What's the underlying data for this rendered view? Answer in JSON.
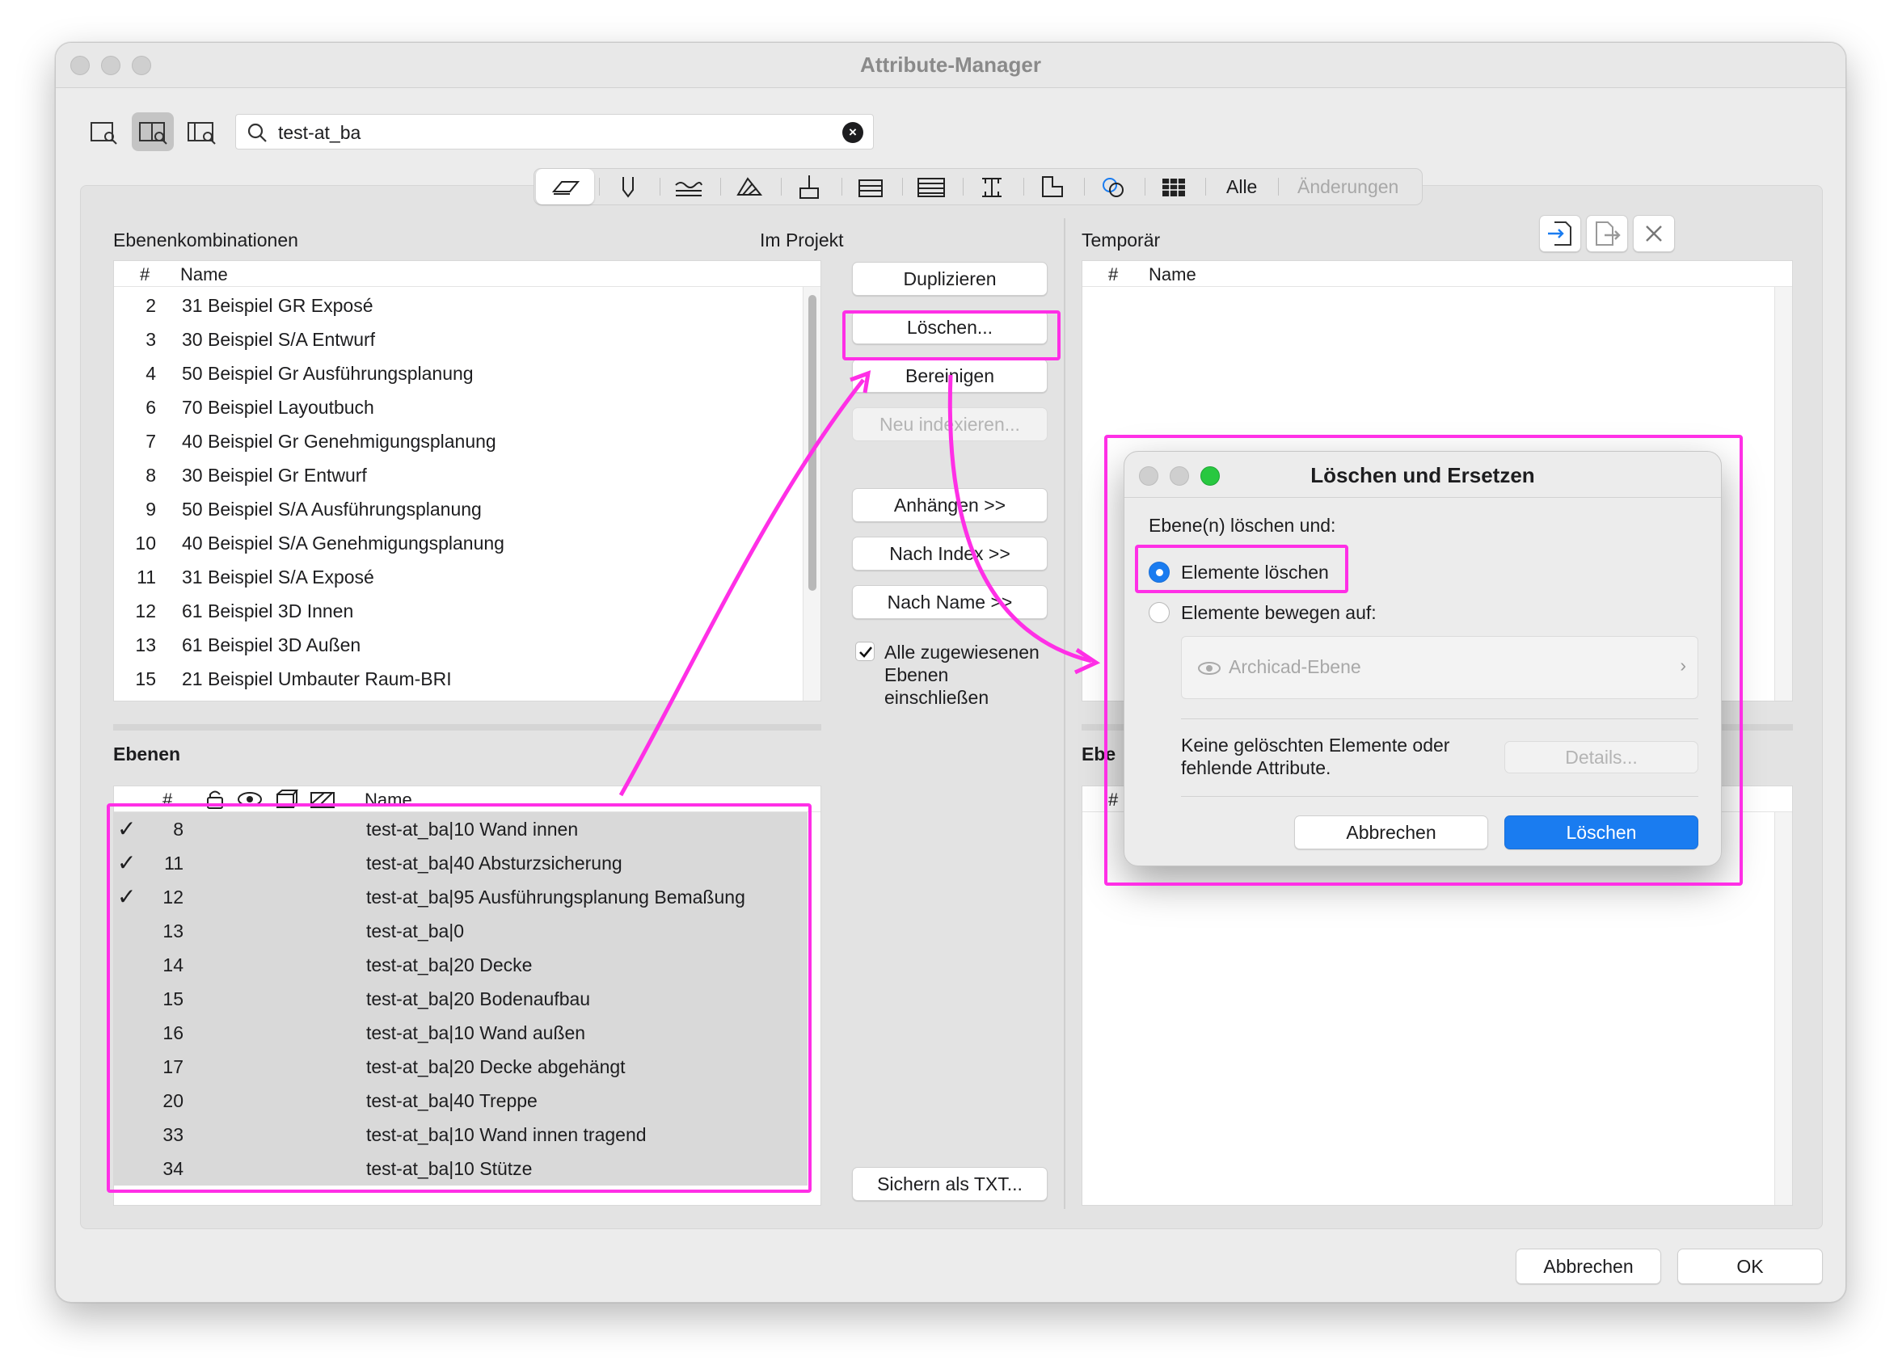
{
  "window": {
    "title": "Attribute-Manager"
  },
  "search": {
    "value": "test-at_ba"
  },
  "filter_bar": {
    "all_label": "Alle",
    "changes_label": "Änderungen"
  },
  "left": {
    "section_label": "Ebenenkombinationen",
    "project_label": "Im Projekt",
    "combos_header": {
      "num": "#",
      "name": "Name"
    },
    "combos": [
      {
        "num": "2",
        "name": "31 Beispiel GR Exposé"
      },
      {
        "num": "3",
        "name": "30 Beispiel S/A Entwurf"
      },
      {
        "num": "4",
        "name": "50 Beispiel Gr Ausführungsplanung"
      },
      {
        "num": "6",
        "name": "70 Beispiel Layoutbuch"
      },
      {
        "num": "7",
        "name": "40 Beispiel Gr Genehmigungsplanung"
      },
      {
        "num": "8",
        "name": "30 Beispiel Gr Entwurf"
      },
      {
        "num": "9",
        "name": "50 Beispiel S/A Ausführungsplanung"
      },
      {
        "num": "10",
        "name": "40 Beispiel S/A Genehmigungsplanung"
      },
      {
        "num": "11",
        "name": "31 Beispiel S/A Exposé"
      },
      {
        "num": "12",
        "name": "61 Beispiel 3D Innen"
      },
      {
        "num": "13",
        "name": "61 Beispiel 3D Außen"
      },
      {
        "num": "15",
        "name": "21 Beispiel Umbauter Raum-BRI"
      }
    ],
    "layers_label": "Ebenen",
    "layers_header": {
      "num": "#",
      "name": "Name"
    },
    "layers": [
      {
        "num": "8",
        "name": "test-at_ba|10 Wand innen",
        "checked": "✓"
      },
      {
        "num": "11",
        "name": "test-at_ba|40 Absturzsicherung",
        "checked": "✓"
      },
      {
        "num": "12",
        "name": "test-at_ba|95 Ausführungsplanung Bemaßung",
        "checked": "✓"
      },
      {
        "num": "13",
        "name": "test-at_ba|0",
        "checked": ""
      },
      {
        "num": "14",
        "name": "test-at_ba|20 Decke",
        "checked": ""
      },
      {
        "num": "15",
        "name": "test-at_ba|20 Bodenaufbau",
        "checked": ""
      },
      {
        "num": "16",
        "name": "test-at_ba|10 Wand außen",
        "checked": ""
      },
      {
        "num": "17",
        "name": "test-at_ba|20 Decke abgehängt",
        "checked": ""
      },
      {
        "num": "20",
        "name": "test-at_ba|40 Treppe",
        "checked": ""
      },
      {
        "num": "33",
        "name": "test-at_ba|10 Wand innen tragend",
        "checked": ""
      },
      {
        "num": "34",
        "name": "test-at_ba|10 Stütze",
        "checked": ""
      }
    ]
  },
  "middle": {
    "duplicate": "Duplizieren",
    "delete": "Löschen...",
    "cleanup": "Bereinigen",
    "reindex": "Neu indexieren...",
    "append": "Anhängen >>",
    "by_index": "Nach Index >>",
    "by_name": "Nach Name >>",
    "include_label_1": "Alle zugewiesenen",
    "include_label_2": "Ebenen",
    "include_label_3": "einschließen",
    "save_txt": "Sichern als TXT..."
  },
  "right": {
    "section_label": "Temporär",
    "header": {
      "num": "#",
      "name": "Name"
    },
    "layers_label_partial": "Ebe",
    "num_partial": "#"
  },
  "dialog": {
    "title": "Löschen und Ersetzen",
    "prompt": "Ebene(n) löschen und:",
    "option_delete": "Elemente löschen",
    "option_move": "Elemente bewegen auf:",
    "picker_value": "Archicad-Ebene",
    "info_line1": "Keine gelöschten Elemente oder",
    "info_line2": "fehlende Attribute.",
    "details": "Details...",
    "cancel": "Abbrechen",
    "confirm": "Löschen"
  },
  "footer": {
    "cancel": "Abbrechen",
    "ok": "OK"
  },
  "colors": {
    "highlight": "#ff2fe6",
    "accent": "#1a7cf0"
  }
}
